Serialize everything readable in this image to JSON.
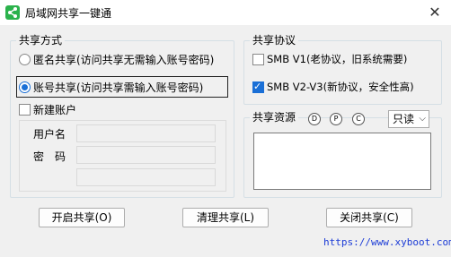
{
  "window": {
    "title": "局域网共享一键通",
    "close_glyph": "✕",
    "icon": "share-icon"
  },
  "share_mode": {
    "title": "共享方式",
    "anonymous_label": "匿名共享(访问共享无需输入账号密码)",
    "account_label": "账号共享(访问共享需输入账号密码)",
    "selected": "account",
    "new_account_label": "新建账户",
    "new_account_checked": false,
    "username_label": "用户名",
    "password_label": "密　码",
    "username_value": "",
    "password_value": "",
    "password_confirm_value": ""
  },
  "protocol": {
    "title": "共享协议",
    "smb1_label": "SMB V1(老协议，旧系统需要)",
    "smb1_checked": false,
    "smb2_label": "SMB V2-V3(新协议，安全性高)",
    "smb2_checked": true
  },
  "resources": {
    "title": "共享资源",
    "drives": [
      "D",
      "P",
      "C"
    ],
    "permission_value": "只读",
    "permission_options": [
      "只读"
    ]
  },
  "buttons": {
    "open": "开启共享(O)",
    "clean": "清理共享(L)",
    "close": "关闭共享(C)"
  },
  "footer": {
    "url": "https://www.xyboot.com"
  },
  "colors": {
    "accent": "#1a6fd6",
    "icon_green": "#2bb24c",
    "link": "#1b3bd6"
  }
}
